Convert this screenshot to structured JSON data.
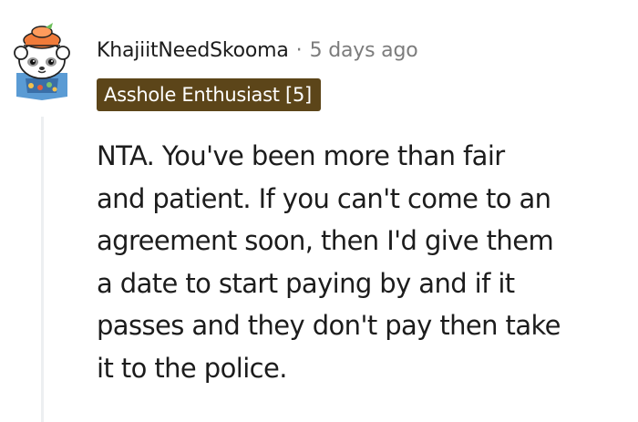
{
  "comment": {
    "username": "KhajiitNeedSkooma",
    "separator": "·",
    "timestamp": "5 days ago",
    "flair": "Asshole Enthusiast [5]",
    "avatar_icon": "snoo-avatar-icon",
    "flair_color": "#5c4519",
    "body_lines": [
      "NTA. You've been more than fair",
      "and patient. If you can't come to an",
      "agreement soon, then I'd give them",
      "a date to start paying by and if it",
      "passes and they don't pay then take",
      "it to the police."
    ]
  }
}
